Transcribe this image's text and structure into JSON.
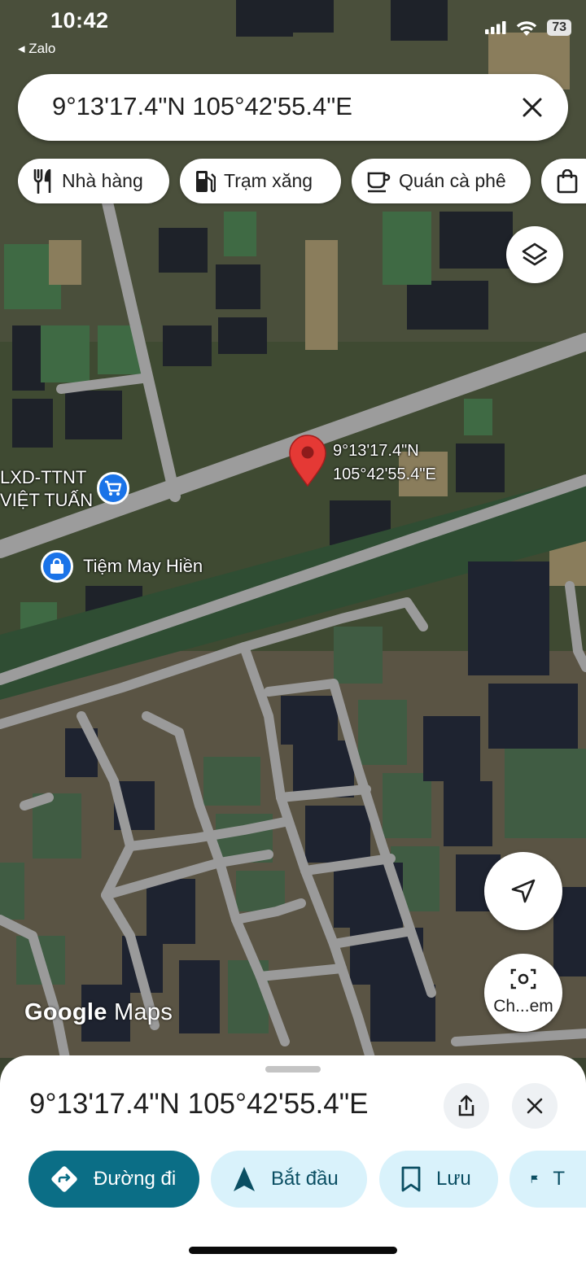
{
  "status_bar": {
    "time": "10:42",
    "back_app": "◂ Zalo",
    "battery": "73",
    "icons": [
      "signal-icon",
      "wifi-icon",
      "battery-icon"
    ]
  },
  "search": {
    "value": "9°13'17.4\"N 105°42'55.4\"E",
    "close_icon": "close-icon"
  },
  "chips": [
    {
      "label": "Nhà hàng",
      "icon": "restaurant-icon"
    },
    {
      "label": "Trạm xăng",
      "icon": "gas-station-icon"
    },
    {
      "label": "Quán cà phê",
      "icon": "coffee-icon"
    },
    {
      "label": "",
      "icon": "shopping-bag-icon"
    }
  ],
  "map": {
    "pin_label_line1": "9°13'17.4\"N",
    "pin_label_line2": "105°42'55.4\"E",
    "poi_1": {
      "line1": "LXD-TTNT",
      "line2": "VIỆT TUẤN",
      "icon": "shopping-cart-icon"
    },
    "poi_2": {
      "label": "Tiệm May Hiền",
      "icon": "shopping-bag-icon"
    },
    "logo_google": "Google",
    "logo_maps": "Maps",
    "layers_icon": "layers-icon",
    "navigate_icon": "navigation-arrow-icon",
    "camera_label": "Ch...em",
    "camera_icon": "camera-search-icon",
    "colors": {
      "pin": "#e53935",
      "poi": "#1a73e8",
      "road": "#9c9c9c"
    }
  },
  "sheet": {
    "title": "9°13'17.4\"N 105°42'55.4\"E",
    "share_icon": "share-icon",
    "close_icon": "close-icon",
    "actions": [
      {
        "label": "Đường đi",
        "icon": "directions-icon"
      },
      {
        "label": "Bắt đầu",
        "icon": "navigation-icon"
      },
      {
        "label": "Lưu",
        "icon": "bookmark-icon"
      },
      {
        "label": "T",
        "icon": "flag-icon"
      }
    ],
    "colors": {
      "primary": "#0b6e86",
      "secondary": "#d9f2fb"
    }
  }
}
